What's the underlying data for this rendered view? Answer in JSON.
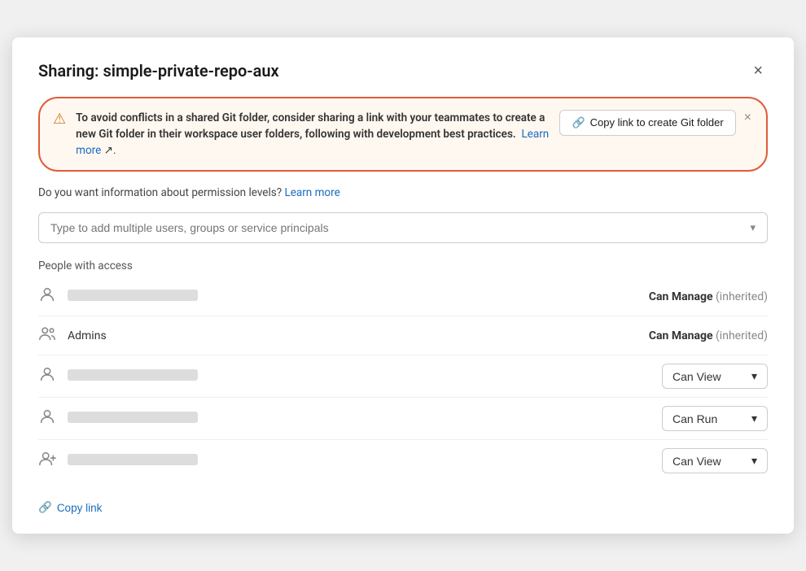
{
  "modal": {
    "title": "Sharing: simple-private-repo-aux",
    "close_label": "×"
  },
  "warning": {
    "icon": "⚠",
    "text_strong": "To avoid conflicts in a shared Git folder, consider sharing a link with your teammates to create a new Git folder in their workspace user folders, following with development best practices.",
    "learn_more": "Learn more",
    "copy_git_btn": "Copy link to create Git folder",
    "close_label": "×"
  },
  "permission_info": {
    "text": "Do you want information about permission levels?",
    "learn_more": "Learn more"
  },
  "add_users": {
    "placeholder": "Type to add multiple users, groups or service principals"
  },
  "people_section": {
    "label": "People with access"
  },
  "people": [
    {
      "icon": "person",
      "name_blurred": true,
      "name": "",
      "permission_type": "text",
      "permission": "Can Manage",
      "inherited": "(inherited)"
    },
    {
      "icon": "group",
      "name_blurred": false,
      "name": "Admins",
      "permission_type": "text",
      "permission": "Can Manage",
      "inherited": "(inherited)"
    },
    {
      "icon": "person",
      "name_blurred": true,
      "name": "",
      "permission_type": "dropdown",
      "permission": "Can View"
    },
    {
      "icon": "person",
      "name_blurred": true,
      "name": "",
      "permission_type": "dropdown",
      "permission": "Can Run"
    },
    {
      "icon": "person-add",
      "name_blurred": true,
      "name": "",
      "permission_type": "dropdown",
      "permission": "Can View"
    }
  ],
  "footer": {
    "copy_link_label": "Copy link"
  }
}
